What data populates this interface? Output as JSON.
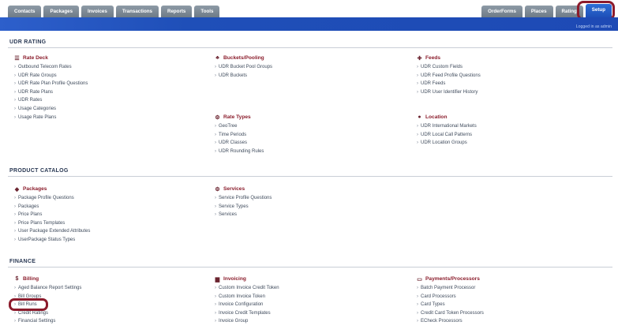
{
  "nav": {
    "left_tabs": [
      "Contacts",
      "Packages",
      "Invoices",
      "Transactions",
      "Reports",
      "Tools"
    ],
    "right_tabs": [
      "OrderForms",
      "Places",
      "Rating",
      "Setup"
    ],
    "logged_in": "Logged in as admin"
  },
  "sections": {
    "udr_rating": "UDR RATING",
    "product_catalog": "PRODUCT CATALOG",
    "finance": "FINANCE"
  },
  "groups": {
    "rate_deck": {
      "title": "Rate Deck",
      "icon": "list-icon",
      "items": [
        "Outbound Telecom Rates",
        "UDR Rate Groups",
        "UDR Rate Plan Profile Questions",
        "UDR Rate Plans",
        "UDR Rates",
        "Usage Categories",
        "Usage Rate Plans"
      ]
    },
    "buckets_pooling": {
      "title": "Buckets/Pooling",
      "icon": "sitemap-icon",
      "items": [
        "UDR Bucket Pool Groups",
        "UDR Buckets"
      ]
    },
    "feeds": {
      "title": "Feeds",
      "icon": "plus-icon",
      "items": [
        "UDR Custom Fields",
        "UDR Feed Profile Questions",
        "UDR Feeds",
        "UDR User Identifier History"
      ]
    },
    "rate_types": {
      "title": "Rate Types",
      "icon": "sliders-icon",
      "items": [
        "GeoTree",
        "Time Periods",
        "UDR Classes",
        "UDR Rounding Rules"
      ]
    },
    "location": {
      "title": "Location",
      "icon": "globe-icon",
      "items": [
        "UDR International Markets",
        "UDR Local Call Patterns",
        "UDR Location Groups"
      ]
    },
    "packages": {
      "title": "Packages",
      "icon": "box-icon",
      "items": [
        "Package Profile Questions",
        "Packages",
        "Price Plans",
        "Price Plans Templates",
        "User Package Extended Attributes",
        "UserPackage Status Types"
      ]
    },
    "services": {
      "title": "Services",
      "icon": "cogs-icon",
      "items": [
        "Service Profile Questions",
        "Service Types",
        "Services"
      ]
    },
    "billing": {
      "title": "Billing",
      "icon": "dollar-icon",
      "items": [
        "Aged Balance Report Settings",
        "Bill Groups",
        "Bill Runs",
        "Credit Ratings",
        "Financial Settings"
      ]
    },
    "invoicing": {
      "title": "Invoicing",
      "icon": "document-icon",
      "items": [
        "Custom Invoice Credit Token",
        "Custom Invoice Token",
        "Invoice Configuration",
        "Invoice Credit Templates",
        "Invoice Group"
      ]
    },
    "payments": {
      "title": "Payments/Processors",
      "icon": "credit-card-icon",
      "items": [
        "Batch Payment Processor",
        "Card Processors",
        "Card Types",
        "Credit Card Token Processors",
        "ECheck Processors"
      ]
    }
  },
  "colors": {
    "banner": "#1f4fb8",
    "group_title": "#8b1d2c",
    "highlight": "#8c1b2c"
  }
}
